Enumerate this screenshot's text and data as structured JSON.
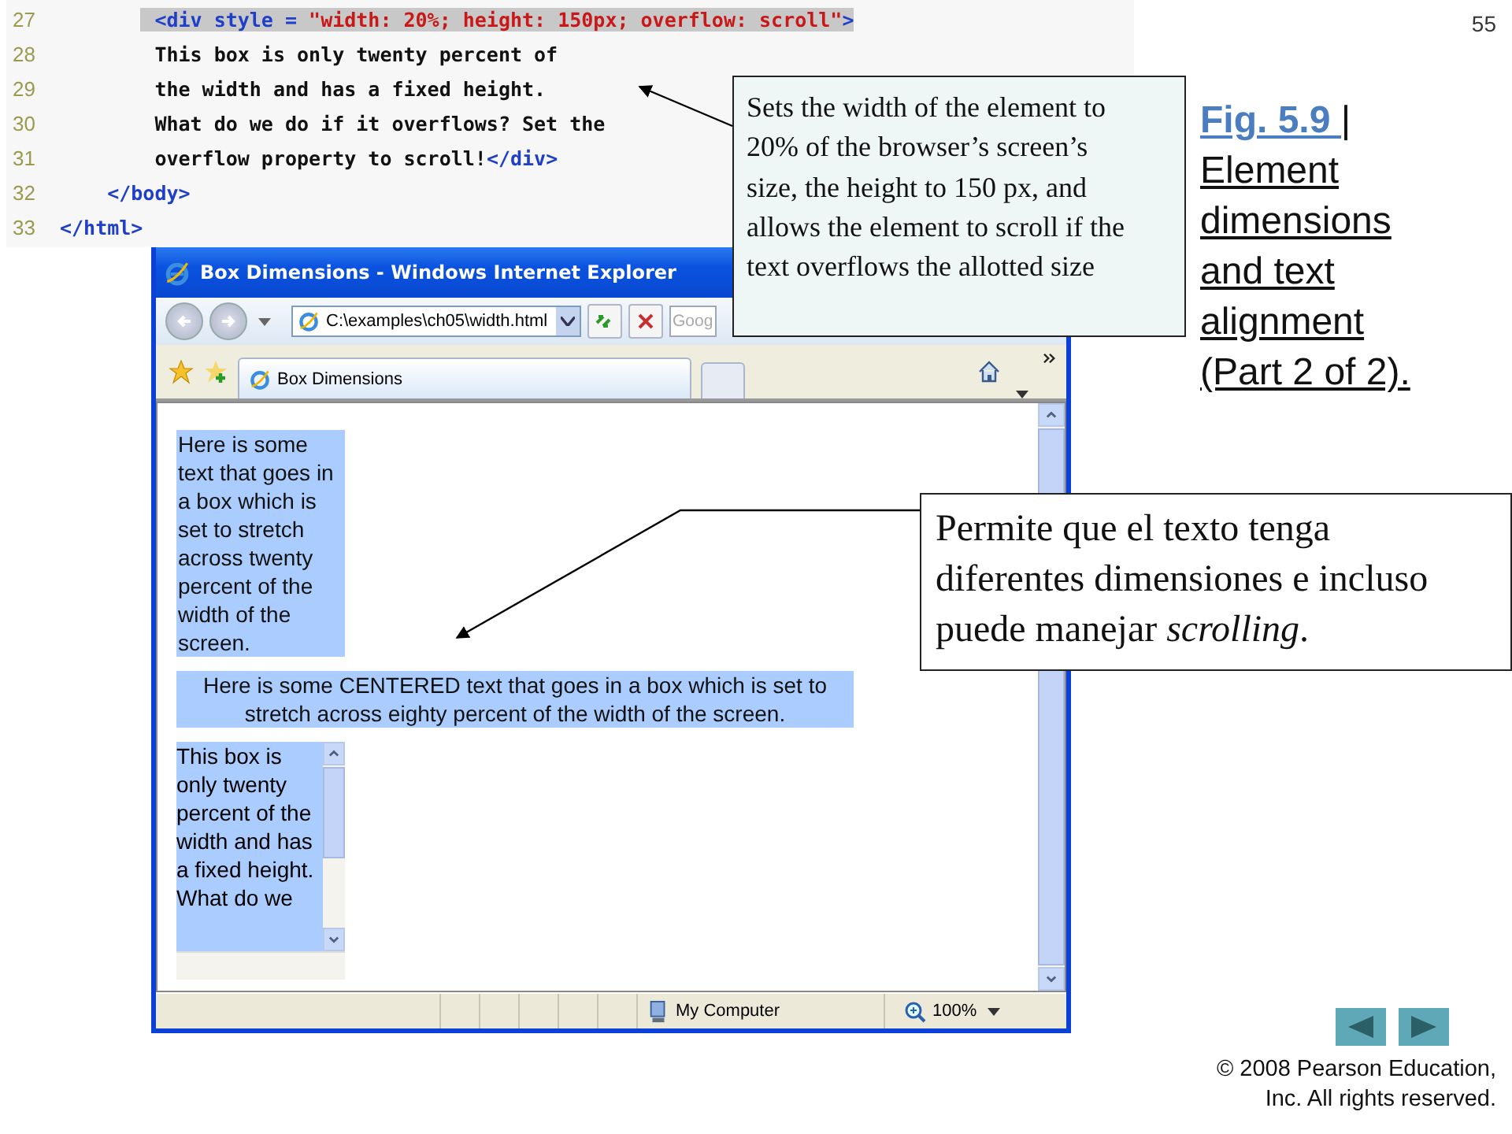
{
  "page_number": "55",
  "code_listing": {
    "lines": [
      {
        "number": "27",
        "highlighted": true,
        "segments": [
          {
            "kind": "tag",
            "text": "        <div style = "
          },
          {
            "kind": "string",
            "text": "\"width: 20%; height: 150px; overflow: scroll\""
          },
          {
            "kind": "tag",
            "text": ">"
          }
        ]
      },
      {
        "number": "28",
        "highlighted": false,
        "segments": [
          {
            "kind": "text",
            "text": "        This box is only twenty percent of"
          }
        ]
      },
      {
        "number": "29",
        "highlighted": false,
        "segments": [
          {
            "kind": "text",
            "text": "        the width and has a fixed height."
          }
        ]
      },
      {
        "number": "30",
        "highlighted": false,
        "segments": [
          {
            "kind": "text",
            "text": "        What do we do if it overflows? Set the"
          }
        ]
      },
      {
        "number": "31",
        "highlighted": false,
        "segments": [
          {
            "kind": "text",
            "text": "        overflow property to scroll!"
          },
          {
            "kind": "tag",
            "text": "</div>"
          }
        ]
      },
      {
        "number": "32",
        "highlighted": false,
        "segments": [
          {
            "kind": "tag",
            "text": "    </body>"
          }
        ]
      },
      {
        "number": "33",
        "highlighted": false,
        "segments": [
          {
            "kind": "tag",
            "text": "</html>"
          }
        ]
      }
    ]
  },
  "browser": {
    "title": "Box Dimensions - Windows Internet Explorer",
    "address": "C:\\examples\\ch05\\width.html",
    "search": {
      "placeholder": "Goog"
    },
    "tabs": [
      {
        "label": "Box Dimensions",
        "selected": true
      },
      {
        "selected": false
      }
    ],
    "content": [
      {
        "kind": "left",
        "text": "Here is some text that goes in a box which is set to stretch across twenty percent of the width of the screen."
      },
      {
        "kind": "centered",
        "text": "Here is some CENTERED text that goes in a box which is set to stretch across eighty percent of the width of the screen."
      },
      {
        "kind": "scroll",
        "text": "This box is only twenty percent of the width and has a fixed height. What do we"
      }
    ],
    "status_bar": {
      "zone": "My Computer",
      "zoom": "100%"
    }
  },
  "callouts": [
    {
      "kind": "top",
      "text": "Sets the width of the element to 20% of the browser’s screen’s size, the height to 150 px, and allows the element to scroll if the text overflows the allotted size"
    },
    {
      "kind": "middle",
      "text": "Permite que el texto tenga diferentes dimensiones e incluso puede manejar *scrolling*."
    }
  ],
  "caption": {
    "link": "Fig. 5.9 ",
    "text": "| Element dimensions and text alignment (Part 2 of 2)."
  },
  "copyright": "© 2008 Pearson Education, Inc.  All rights reserved."
}
